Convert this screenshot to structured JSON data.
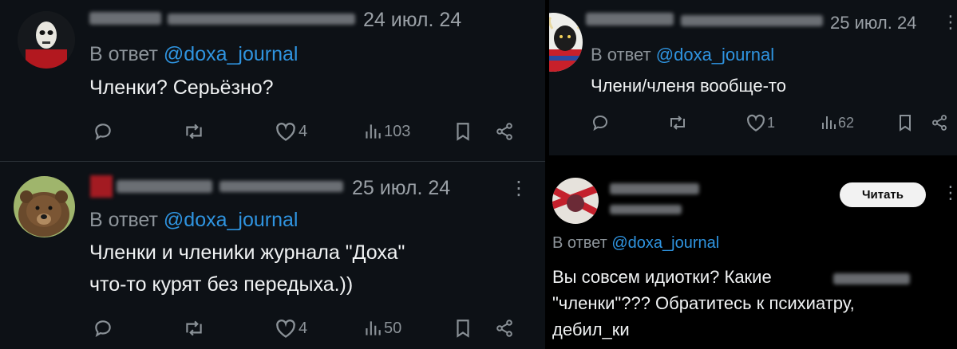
{
  "colors": {
    "background": "#0d1116",
    "handle": "#2f94e0",
    "muted": "#8d949a",
    "text": "#f0f2f3"
  },
  "tweets": [
    {
      "date": "24 июл. 24",
      "reply_prefix": "В ответ",
      "reply_handle": "@doxa_journal",
      "lines": [
        "Членки? Серьёзно?"
      ],
      "likes": "4",
      "views": "103"
    },
    {
      "date": "25 июл. 24",
      "reply_prefix": "В ответ",
      "reply_handle": "@doxa_journal",
      "lines": [
        "Членки и члениkи журнала \"Доха\"",
        "что-то курят без передыха.))"
      ],
      "likes": "4",
      "views": "50"
    },
    {
      "date": "25 июл. 24",
      "reply_prefix": "В ответ",
      "reply_handle": "@doxa_journal",
      "lines": [
        "Члени/членя вообще-то"
      ],
      "likes": "1",
      "views": "62"
    },
    {
      "read_button": "Читать",
      "reply_prefix": "В ответ",
      "reply_handle": "@doxa_journal",
      "lines": [
        "Вы совсем идиотки? Какие",
        "\"членки\"??? Обратитесь к психиатру,",
        "дебил_ки"
      ]
    }
  ]
}
